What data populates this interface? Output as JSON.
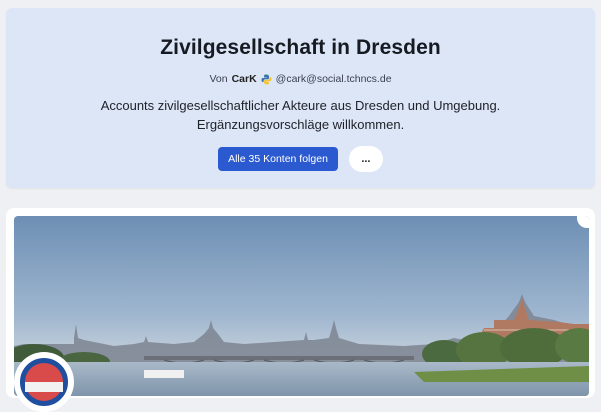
{
  "list": {
    "title": "Zivilgesellschaft in Dresden",
    "by_prefix": "Von",
    "author_name": "CarK",
    "author_handle": "@cark@social.tchncs.de",
    "description": "Accounts zivilgesellschaftlicher Akteure aus Dresden und Umgebung. Ergänzungsvorschläge willkommen.",
    "follow_label": "Alle 35 Konten folgen",
    "more_label": "..."
  },
  "icons": {
    "author_emoji": "python-logo-icon",
    "avatar": "fff-badge-icon"
  },
  "colors": {
    "header_bg": "#dde6f6",
    "accent": "#2b59cf",
    "page_bg": "#eef0f4"
  }
}
